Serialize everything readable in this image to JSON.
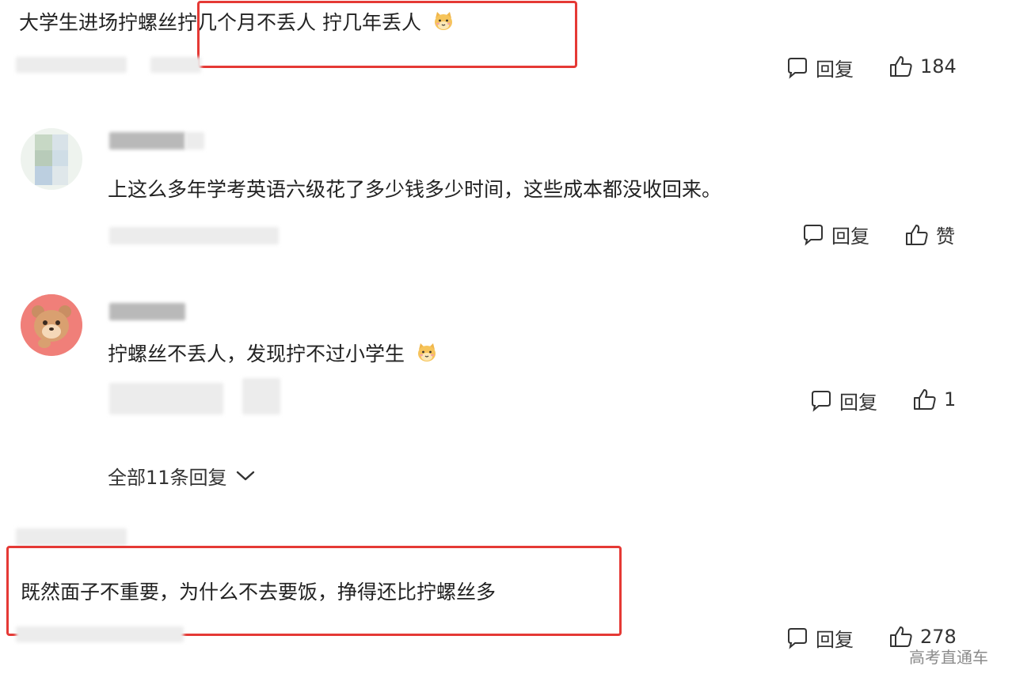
{
  "comments": [
    {
      "text": "大学生进场拧螺丝",
      "highlight_text": "拧几个月不丢人 拧几年丢人",
      "emoji": "cat-emoji",
      "reply_label": "回复",
      "like_count": "184"
    },
    {
      "text": "上这么多年学考英语六级花了多少钱多少时间，这些成本都没收回来。",
      "reply_label": "回复",
      "like_label": "赞"
    },
    {
      "text": "拧螺丝不丢人，发现拧不过小学生",
      "emoji": "cat-emoji",
      "reply_label": "回复",
      "like_count": "1"
    },
    {
      "text": "既然面子不重要，为什么不去要饭，挣得还比拧螺丝多",
      "reply_label": "回复",
      "like_count": "278"
    }
  ],
  "expand_replies": {
    "label": "全部11条回复",
    "icon": "chevron-down-icon"
  },
  "watermark": "高考直通车",
  "colors": {
    "highlight_border": "#e53935",
    "text": "#222222",
    "muted": "#8a8a8a"
  }
}
